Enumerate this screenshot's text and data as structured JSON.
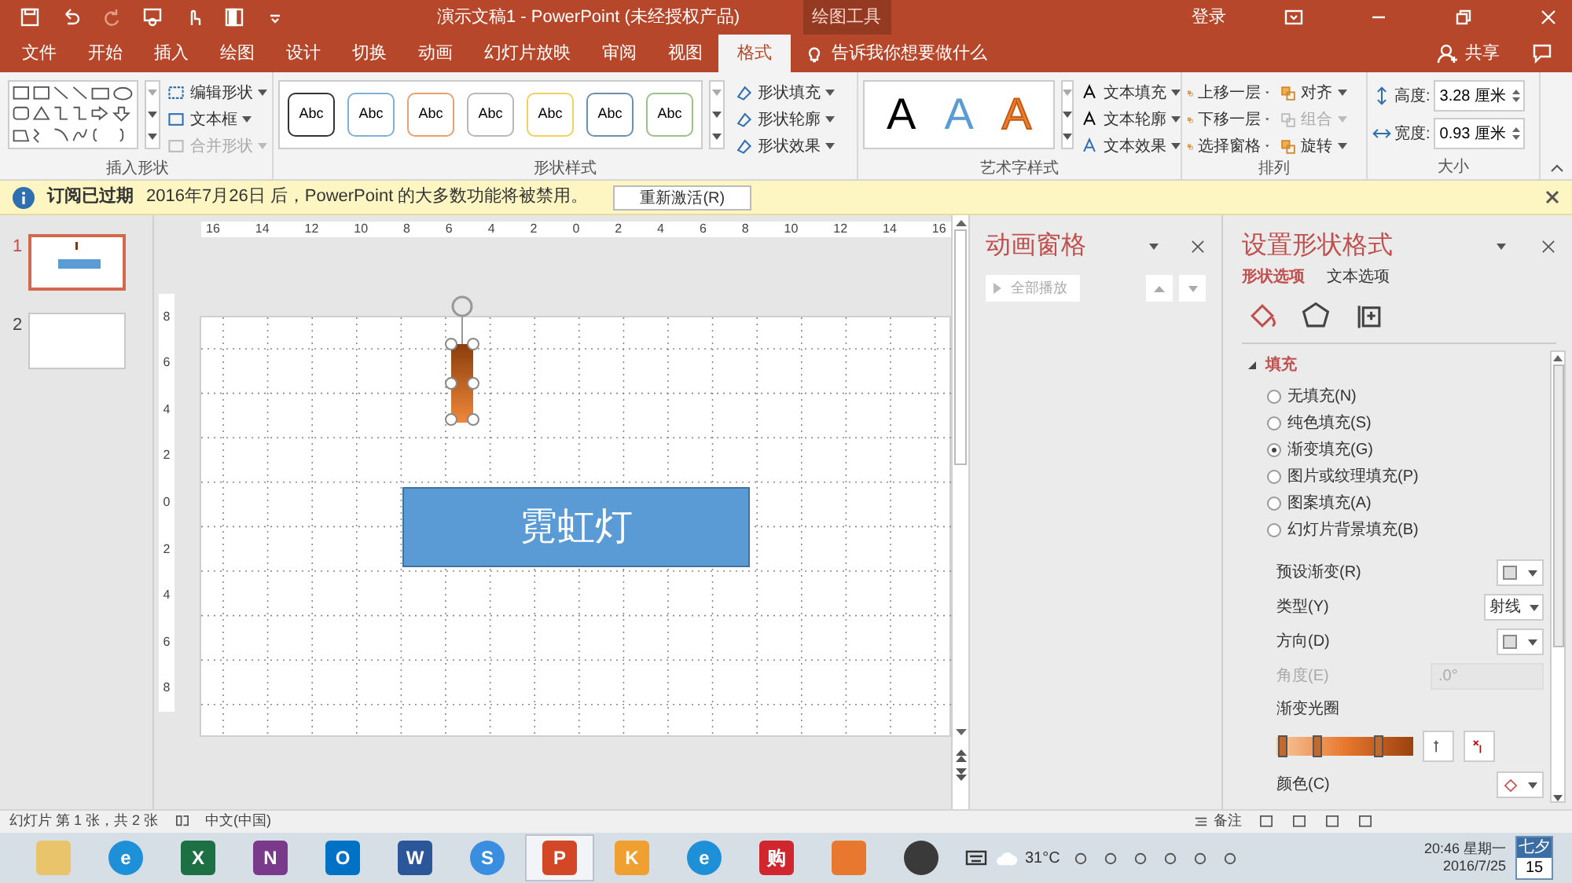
{
  "title_bar": {
    "title": "演示文稿1 - PowerPoint (未经授权产品)",
    "context_label": "绘图工具",
    "sign_in": "登录"
  },
  "ribbon_tabs": [
    {
      "label": "文件",
      "selected": false
    },
    {
      "label": "开始",
      "selected": false
    },
    {
      "label": "插入",
      "selected": false
    },
    {
      "label": "绘图",
      "selected": false
    },
    {
      "label": "设计",
      "selected": false
    },
    {
      "label": "切换",
      "selected": false
    },
    {
      "label": "动画",
      "selected": false
    },
    {
      "label": "幻灯片放映",
      "selected": false
    },
    {
      "label": "审阅",
      "selected": false
    },
    {
      "label": "视图",
      "selected": false
    },
    {
      "label": "格式",
      "selected": true
    }
  ],
  "tell_me": "告诉我你想要做什么",
  "share": "共享",
  "insert_shapes": {
    "title": "插入形状",
    "buttons": [
      {
        "label": "编辑形状",
        "disabled": false
      },
      {
        "label": "文本框",
        "disabled": false
      },
      {
        "label": "合并形状",
        "disabled": true
      }
    ]
  },
  "shape_styles": {
    "title": "形状样式",
    "presets": [
      {
        "label": "Abc",
        "color": "#333333"
      },
      {
        "label": "Abc",
        "color": "#7fb0d6"
      },
      {
        "label": "Abc",
        "color": "#e8a070"
      },
      {
        "label": "Abc",
        "color": "#b8b8b8"
      },
      {
        "label": "Abc",
        "color": "#f2d060"
      },
      {
        "label": "Abc",
        "color": "#6c8fb0"
      },
      {
        "label": "Abc",
        "color": "#9cc08a"
      }
    ],
    "buttons": [
      {
        "label": "形状填充"
      },
      {
        "label": "形状轮廓"
      },
      {
        "label": "形状效果"
      }
    ]
  },
  "wordart": {
    "title": "艺术字样式",
    "samples": [
      {
        "label": "A",
        "color": "#000000",
        "kind": "fill"
      },
      {
        "label": "A",
        "color": "#5b9bd5",
        "kind": "fill"
      },
      {
        "label": "A",
        "color": "#ed7d31",
        "kind": "outline"
      }
    ],
    "buttons": [
      {
        "label": "文本填充"
      },
      {
        "label": "文本轮廓"
      },
      {
        "label": "文本效果"
      }
    ]
  },
  "arrange": {
    "title": "排列",
    "buttons": [
      {
        "label": "上移一层",
        "disabled": false
      },
      {
        "label": "下移一层",
        "disabled": false
      },
      {
        "label": "选择窗格",
        "disabled": false
      },
      {
        "label": "对齐",
        "disabled": false
      },
      {
        "label": "组合",
        "disabled": true
      },
      {
        "label": "旋转",
        "disabled": false
      }
    ]
  },
  "size": {
    "title": "大小",
    "fields": [
      {
        "label": "高度:",
        "value": "3.28 厘米"
      },
      {
        "label": "宽度:",
        "value": "0.93 厘米"
      }
    ]
  },
  "info_bar": {
    "title": "订阅已过期",
    "message": "2016年7月26日 后，PowerPoint 的大多数功能将被禁用。",
    "button": "重新激活(R)"
  },
  "slides": [
    {
      "number": "1",
      "selected": true
    },
    {
      "number": "2",
      "selected": false
    }
  ],
  "ruler_h": [
    "16",
    "14",
    "12",
    "10",
    "8",
    "6",
    "4",
    "2",
    "0",
    "2",
    "4",
    "6",
    "8",
    "10",
    "12",
    "14",
    "16"
  ],
  "ruler_v": [
    "8",
    "6",
    "4",
    "2",
    "0",
    "2",
    "4",
    "6",
    "8"
  ],
  "slide": {
    "shape_text": "霓虹灯"
  },
  "animation_pane": {
    "title": "动画窗格",
    "play_all": {
      "label": "全部播放",
      "disabled": true
    }
  },
  "format_pane": {
    "title": "设置形状格式",
    "tabs": [
      {
        "label": "形状选项",
        "selected": true
      },
      {
        "label": "文本选项",
        "selected": false
      }
    ],
    "section": {
      "title": "填充",
      "expanded": true
    },
    "fill_options": [
      {
        "label": "无填充(N)",
        "selected": false
      },
      {
        "label": "纯色填充(S)",
        "selected": false
      },
      {
        "label": "渐变填充(G)",
        "selected": true
      },
      {
        "label": "图片或纹理填充(P)",
        "selected": false
      },
      {
        "label": "图案填充(A)",
        "selected": false
      },
      {
        "label": "幻灯片背景填充(B)",
        "selected": false
      }
    ],
    "properties": [
      {
        "label": "预设渐变(R)",
        "kind": "swatch"
      },
      {
        "label": "类型(Y)",
        "kind": "select",
        "value": "射线"
      },
      {
        "label": "方向(D)",
        "kind": "swatch"
      },
      {
        "label": "角度(E)",
        "kind": "spin",
        "value": ".0°",
        "disabled": true
      }
    ],
    "gradient_label": "渐变光圈",
    "stops": [
      {
        "level": 0.05
      },
      {
        "level": 0.3
      },
      {
        "level": 0.75
      }
    ],
    "color_label": "颜色(C)"
  },
  "status_bar": {
    "slide_info": "幻灯片 第 1 张，共 2 张",
    "language": "中文(中国)",
    "notes": "备注"
  },
  "taskbar": {
    "apps": [
      {
        "kind": "folder",
        "selected": false
      },
      {
        "kind": "ie",
        "label": "e",
        "selected": false
      },
      {
        "kind": "excel",
        "label": "X",
        "selected": false
      },
      {
        "kind": "onenote",
        "label": "N",
        "selected": false
      },
      {
        "kind": "outlook",
        "label": "O",
        "selected": false
      },
      {
        "kind": "word",
        "label": "W",
        "selected": false
      },
      {
        "kind": "search",
        "label": "S",
        "selected": false
      },
      {
        "kind": "powerpoint",
        "label": "P",
        "selected": true
      },
      {
        "kind": "k",
        "label": "K",
        "selected": false
      },
      {
        "kind": "ie",
        "label": "e",
        "selected": false
      },
      {
        "kind": "shop",
        "label": "购",
        "selected": false
      },
      {
        "kind": "game",
        "selected": false
      },
      {
        "kind": "power",
        "selected": false
      }
    ],
    "temperature": "31°C",
    "time": "20:46 星期一",
    "date": "2016/7/25",
    "calendar_label": "七夕",
    "calendar_day": "15"
  }
}
